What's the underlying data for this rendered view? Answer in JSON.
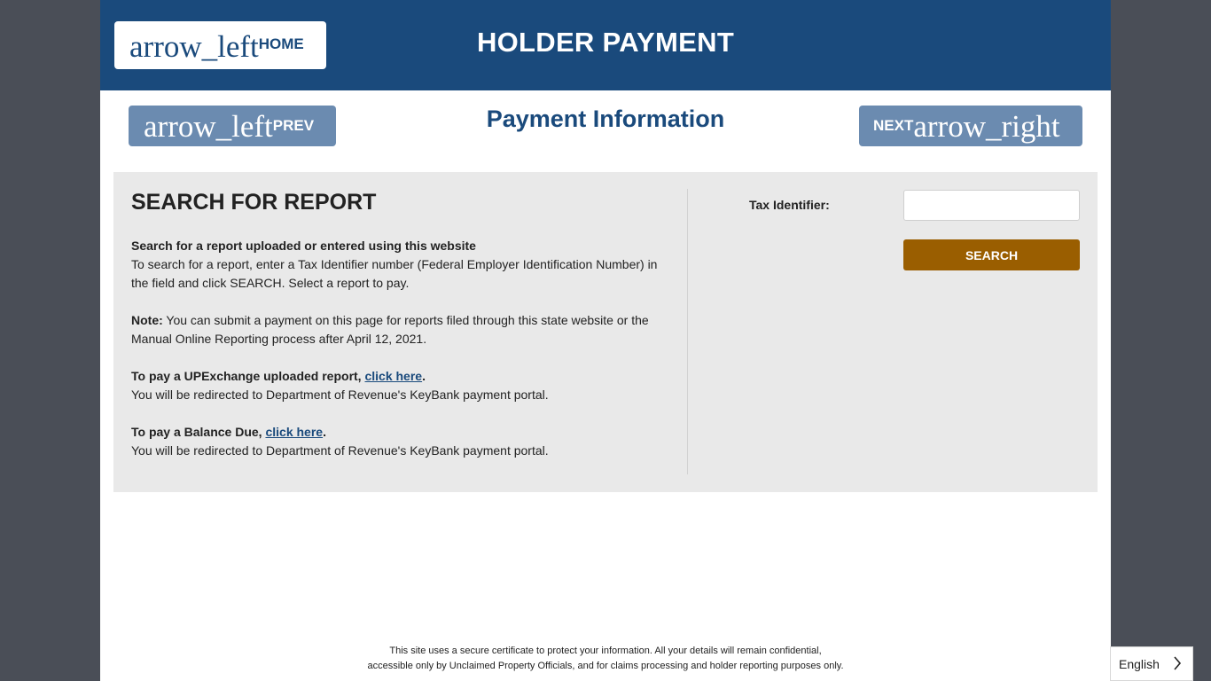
{
  "header": {
    "home_icon_text": "arrow_left",
    "home_label": "HOME",
    "title": "HOLDER PAYMENT"
  },
  "nav": {
    "prev_icon_text": "arrow_left",
    "prev_label": "PREV",
    "subtitle": "Payment Information",
    "next_label": "NEXT",
    "next_icon_text": "arrow_right"
  },
  "search_panel": {
    "title": "SEARCH FOR REPORT",
    "intro_heading": "Search for a report uploaded or entered using this website",
    "intro_text": "To search for a report, enter a Tax Identifier number (Federal Employer Identification Number) in the field and click SEARCH. Select a report to pay.",
    "note_label": "Note:",
    "note_text": " You can submit a payment on this page for reports filed through this state website or the Manual Online Reporting process after April 12, 2021.",
    "upx_lead": "To pay a UPExchange uploaded report, ",
    "upx_link": "click here",
    "upx_period": ".",
    "upx_redirect": "You will be redirected to Department of Revenue's KeyBank payment portal.",
    "balance_lead": "To pay a Balance Due, ",
    "balance_link": "click here",
    "balance_period": ".",
    "balance_redirect": "You will be redirected to Department of Revenue's KeyBank payment portal.",
    "tax_label": "Tax Identifier:",
    "tax_value": "",
    "tax_placeholder": "",
    "search_button": "SEARCH"
  },
  "footer": {
    "line1": "This site uses a secure certificate to protect your information. All your details will remain confidential,",
    "line2": "accessible only by Unclaimed Property Officials, and for claims processing and holder reporting purposes only."
  },
  "language": {
    "selected": "English",
    "icon": "chevron-right-icon"
  },
  "colors": {
    "header_bg": "#1a4a7c",
    "nav_button_bg": "#6b8bb0",
    "search_button_bg": "#9a5e00",
    "panel_bg": "#e9e9e9",
    "outer_bg": "#4a4e57"
  }
}
